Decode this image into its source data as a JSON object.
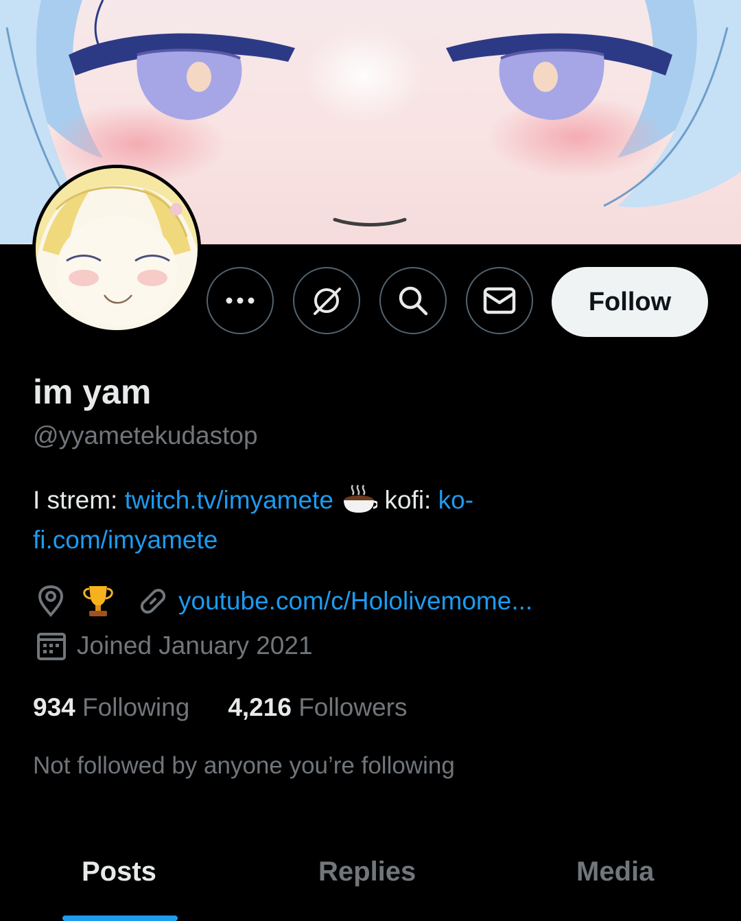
{
  "profile": {
    "name": "im yam",
    "handle": "@yyametekudastop",
    "bio": {
      "prefix": "I strem: ",
      "link1": "twitch.tv/imyamete",
      "middle": " kofi: ",
      "link2_part1": "ko-",
      "link2_part2": "fi.com/imyamete"
    },
    "website": "youtube.com/c/Hololivemome...",
    "joined": "Joined January 2021",
    "following_count": "934",
    "following_label": "Following",
    "followers_count": "4,216",
    "followers_label": "Followers",
    "mutuals_note": "Not followed by anyone you’re following"
  },
  "actions": {
    "follow_label": "Follow"
  },
  "tabs": [
    {
      "label": "Posts",
      "active": true
    },
    {
      "label": "Replies",
      "active": false
    },
    {
      "label": "Media",
      "active": false
    }
  ],
  "icons": {
    "more": "more-icon",
    "grok": "grok-icon",
    "search": "search-icon",
    "message": "message-icon",
    "location": "location-icon",
    "trophy": "trophy-icon",
    "link": "link-icon",
    "calendar": "calendar-icon",
    "coffee": "coffee-emoji"
  },
  "colors": {
    "background": "#000000",
    "text_primary": "#e7e9ea",
    "text_secondary": "#71767b",
    "link": "#1d9bf0",
    "follow_button_bg": "#eff3f4"
  }
}
